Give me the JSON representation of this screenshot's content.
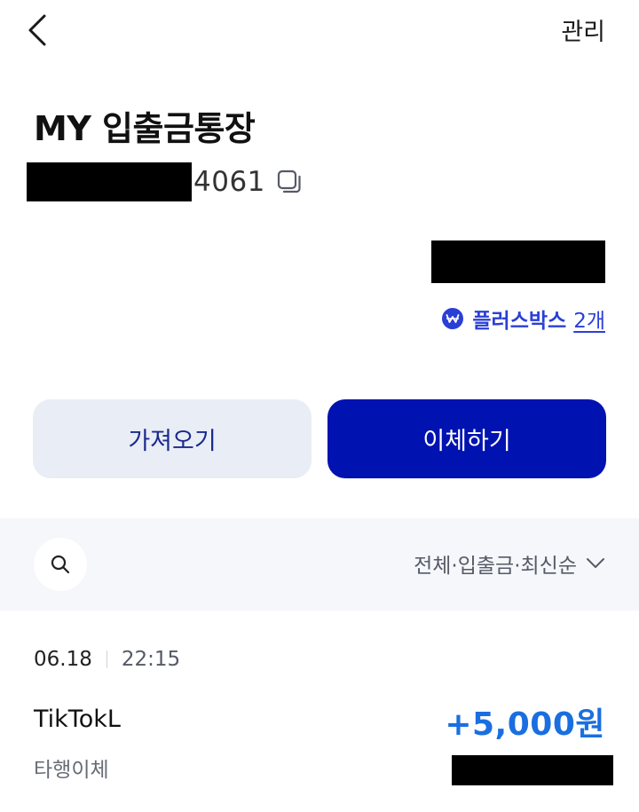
{
  "header": {
    "back_icon": "chevron-left-icon",
    "manage_label": "관리"
  },
  "account": {
    "title": "MY 입출금통장",
    "number_suffix": "4061",
    "copy_icon": "copy-icon"
  },
  "plusbox": {
    "icon": "won-badge-icon",
    "label": "플러스박스",
    "count": "2개"
  },
  "actions": {
    "fetch_label": "가져오기",
    "transfer_label": "이체하기"
  },
  "filter": {
    "search_icon": "search-icon",
    "label": "전체·입출금·최신순",
    "chevron_icon": "chevron-down-icon"
  },
  "transactions": [
    {
      "date": "06.18",
      "time": "22:15",
      "name": "TikTokL",
      "amount": "+5,000원",
      "type": "타행이체"
    }
  ],
  "colors": {
    "primary": "#0012b0",
    "secondary_bg": "#e9edf5",
    "accent_blue": "#2a3fd6",
    "amount_blue": "#1a6fe0",
    "filter_bg": "#f5f7fb"
  }
}
